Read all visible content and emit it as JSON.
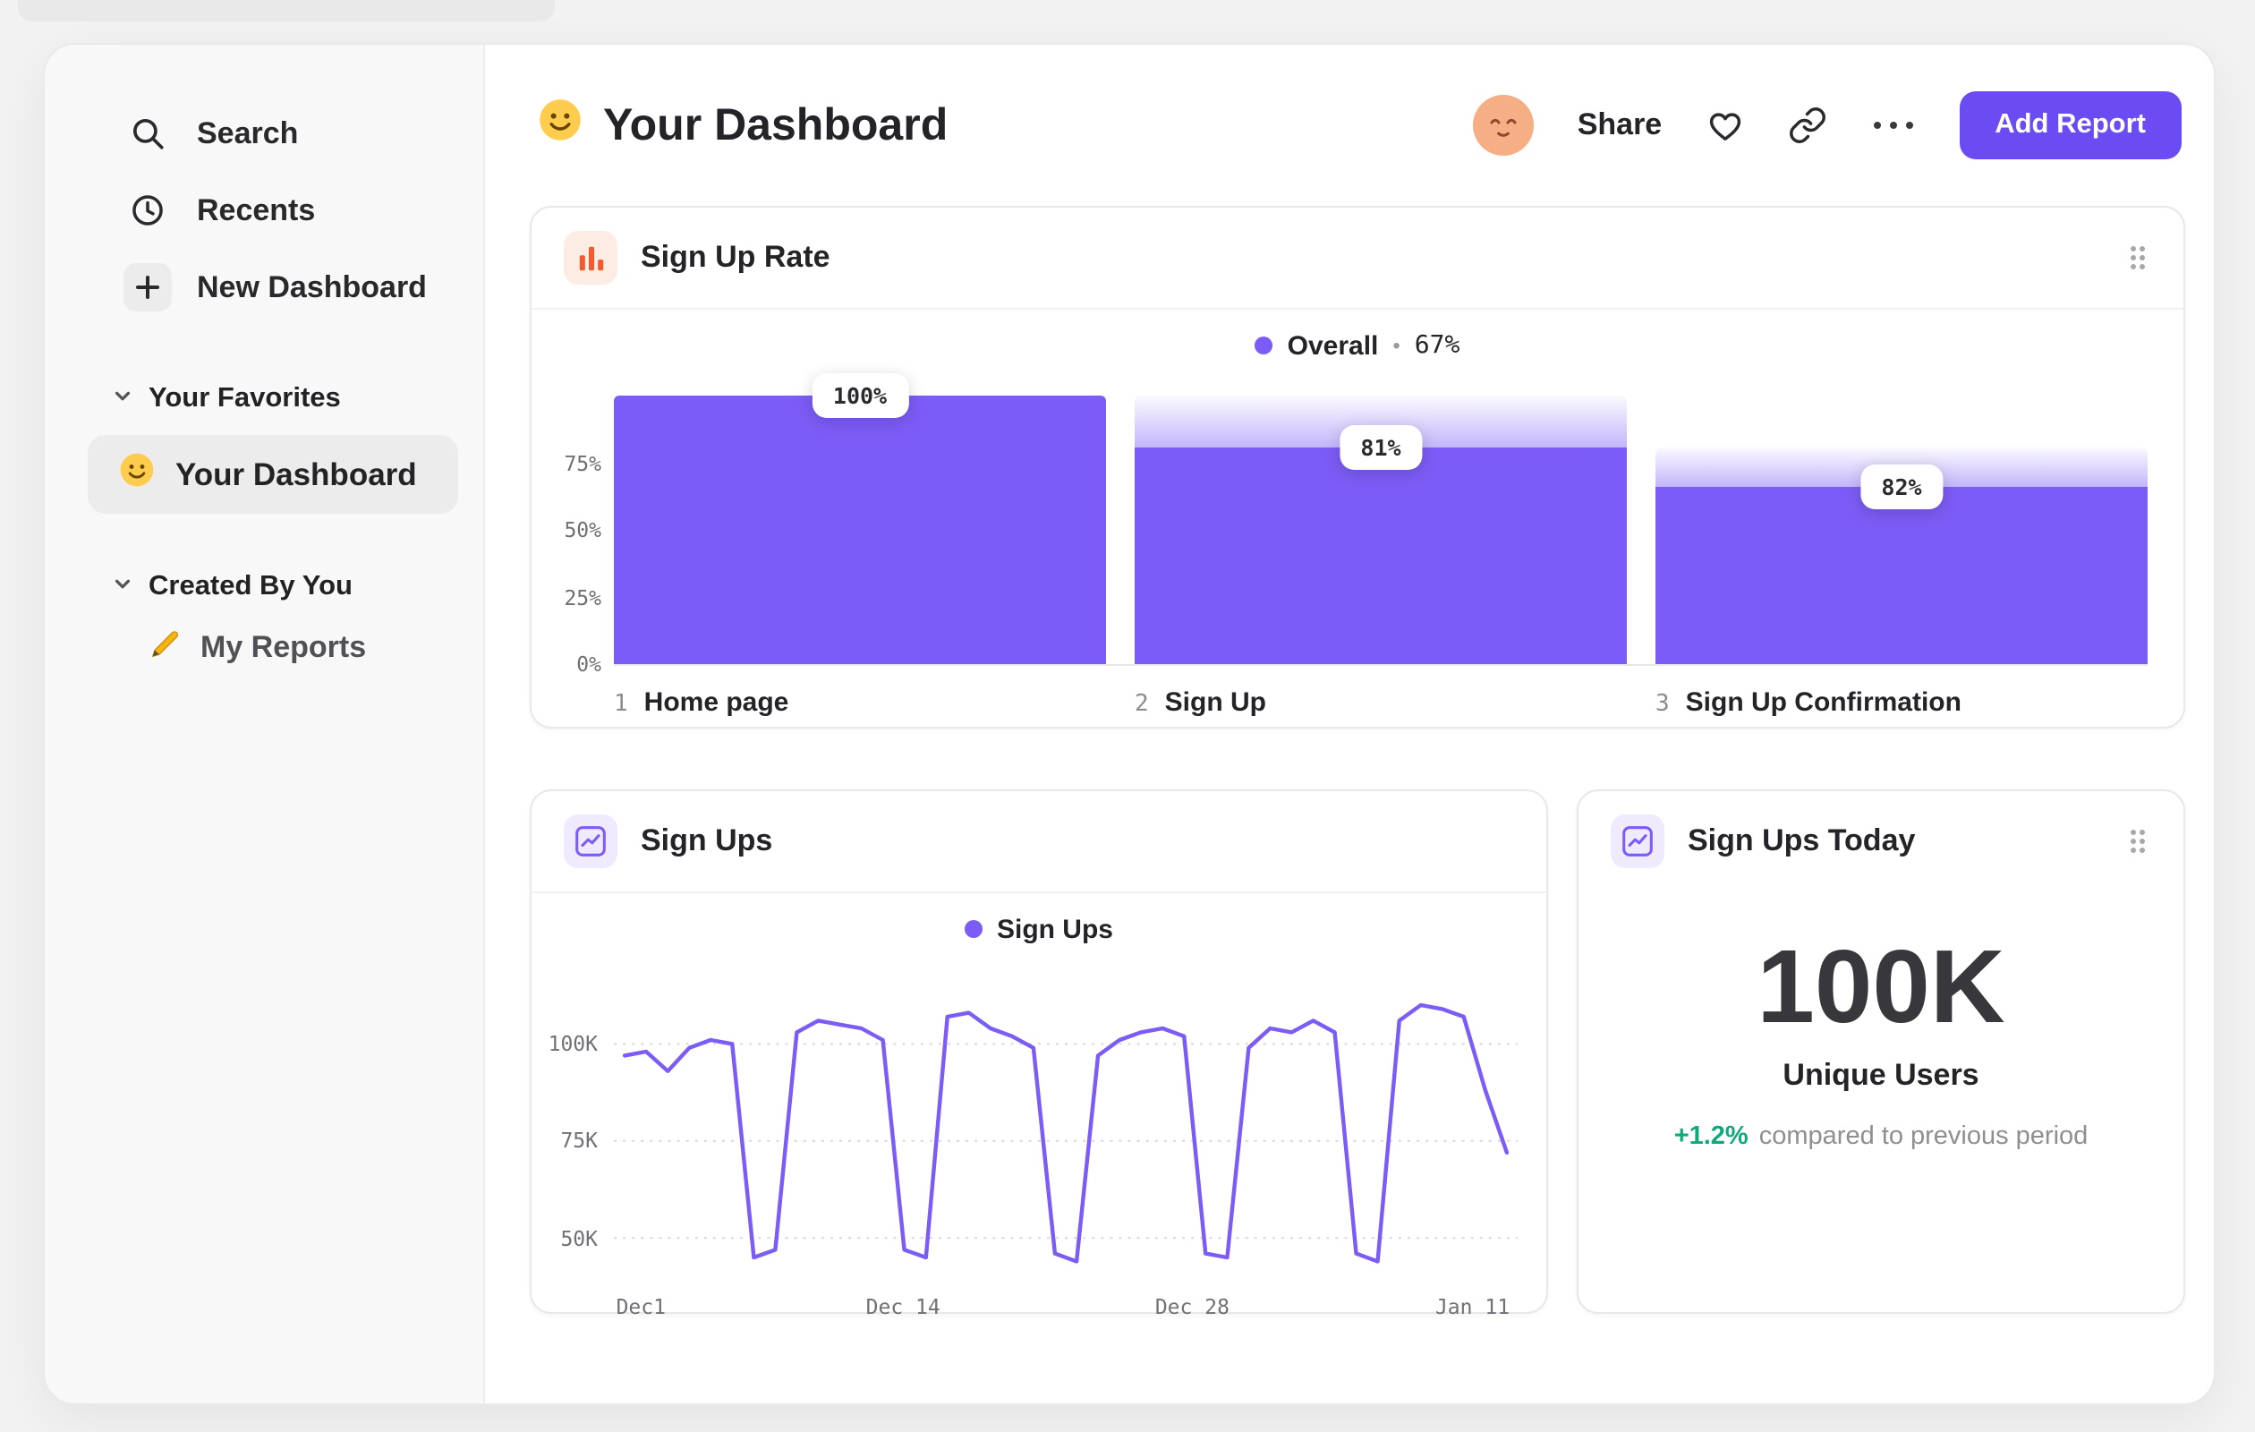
{
  "colors": {
    "accent": "#7C5CF6",
    "button": "#6B4BF2",
    "icon_orange": "#EE5D2F",
    "delta_green": "#12A87D"
  },
  "sidebar": {
    "items": [
      {
        "label": "Search",
        "icon": "search-icon"
      },
      {
        "label": "Recents",
        "icon": "clock-icon"
      },
      {
        "label": "New Dashboard",
        "icon": "plus-icon"
      }
    ],
    "sections": [
      {
        "label": "Your Favorites",
        "icon": "chevron-down-icon",
        "items": [
          {
            "label": "Your Dashboard",
            "icon": "smiley-icon",
            "selected": true
          }
        ]
      },
      {
        "label": "Created By You",
        "icon": "chevron-down-icon",
        "items": [
          {
            "label": "My Reports",
            "icon": "pencil-icon",
            "selected": false
          }
        ]
      }
    ]
  },
  "header": {
    "title": "Your Dashboard",
    "share_label": "Share",
    "add_report_label": "Add Report"
  },
  "chart_data": [
    {
      "type": "bar",
      "subtype": "funnel",
      "title": "Sign Up Rate",
      "legend": {
        "name": "Overall",
        "separator": "•",
        "value": "67%"
      },
      "categories": [
        "Home page",
        "Sign Up",
        "Sign Up Confirmation"
      ],
      "step_numbers": [
        "1",
        "2",
        "3"
      ],
      "step_conversion_labels": [
        "100%",
        "81%",
        "82%"
      ],
      "values_pct_of_total": [
        100,
        81,
        66
      ],
      "band_from_pct": [
        100,
        100,
        81
      ],
      "y_ticks": [
        {
          "label": "75%",
          "value": 75
        },
        {
          "label": "50%",
          "value": 50
        },
        {
          "label": "25%",
          "value": 25
        },
        {
          "label": "0%",
          "value": 0
        }
      ],
      "ylim": [
        0,
        100
      ],
      "bar_color": "#7C5CF6"
    },
    {
      "type": "line",
      "title": "Sign Ups",
      "legend": {
        "name": "Sign Ups"
      },
      "series": [
        {
          "name": "Sign Ups",
          "unit": "K",
          "values": [
            97,
            98,
            93,
            99,
            101,
            100,
            45,
            47,
            103,
            106,
            105,
            104,
            101,
            47,
            45,
            107,
            108,
            104,
            102,
            99,
            46,
            44,
            97,
            101,
            103,
            104,
            102,
            46,
            45,
            99,
            104,
            103,
            106,
            103,
            46,
            44,
            106,
            110,
            109,
            107,
            88,
            72
          ]
        }
      ],
      "x_ticks": [
        {
          "label": "Dec1",
          "frac": 0.03
        },
        {
          "label": "Dec 14",
          "frac": 0.32
        },
        {
          "label": "Dec 28",
          "frac": 0.64
        },
        {
          "label": "Jan 11",
          "frac": 0.95
        }
      ],
      "y_ticks": [
        {
          "label": "100K",
          "value": 100
        },
        {
          "label": "75K",
          "value": 75
        },
        {
          "label": "50K",
          "value": 50
        }
      ],
      "ylim": [
        42,
        113
      ],
      "grid": "dotted-horizontal",
      "line_color": "#7C5CF6"
    },
    {
      "type": "big_number",
      "title": "Sign Ups Today",
      "display": "100K",
      "label": "Unique Users",
      "delta_display": "+1.2%",
      "delta_note": "compared to previous period"
    }
  ]
}
